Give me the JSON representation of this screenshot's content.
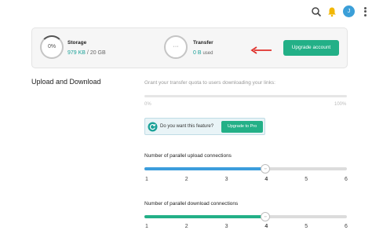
{
  "topbar": {
    "icons": [
      "search-icon",
      "bell-icon",
      "avatar",
      "more-vertical-icon"
    ],
    "avatar_letter": "J",
    "bell_color": "#f2b705"
  },
  "summary": {
    "storage": {
      "percent": "0%",
      "label": "Storage",
      "used": "979 KB",
      "separator": " / ",
      "total": "20 GB"
    },
    "transfer": {
      "ring_text": "···",
      "label": "Transfer",
      "value": "0 B",
      "suffix": "used"
    },
    "upgrade_label": "Upgrade account",
    "annotation_arrow_color": "#e0302a"
  },
  "section": {
    "title": "Upload and Download",
    "grant_text": "Grant your transfer quota to users downloading your links:",
    "quota": {
      "min_label": "0%",
      "max_label": "100%",
      "value": 0
    },
    "pro_banner": {
      "text": "Do you want this feature?",
      "button": "Upgrade to Pro"
    },
    "upload": {
      "label": "Number of parallel upload connections",
      "ticks": [
        "1",
        "2",
        "3",
        "4",
        "5",
        "6"
      ],
      "value": 4,
      "min": 1,
      "max": 6,
      "thumb_glyph": "‹›"
    },
    "download": {
      "label": "Number of parallel download connections",
      "ticks": [
        "1",
        "2",
        "3",
        "4",
        "5",
        "6"
      ],
      "value": 4,
      "min": 1,
      "max": 6,
      "thumb_glyph": "‹›"
    }
  },
  "colors": {
    "accent_green": "#23b087",
    "accent_teal": "#1aa198",
    "upload_blue": "#3c9ddc"
  }
}
